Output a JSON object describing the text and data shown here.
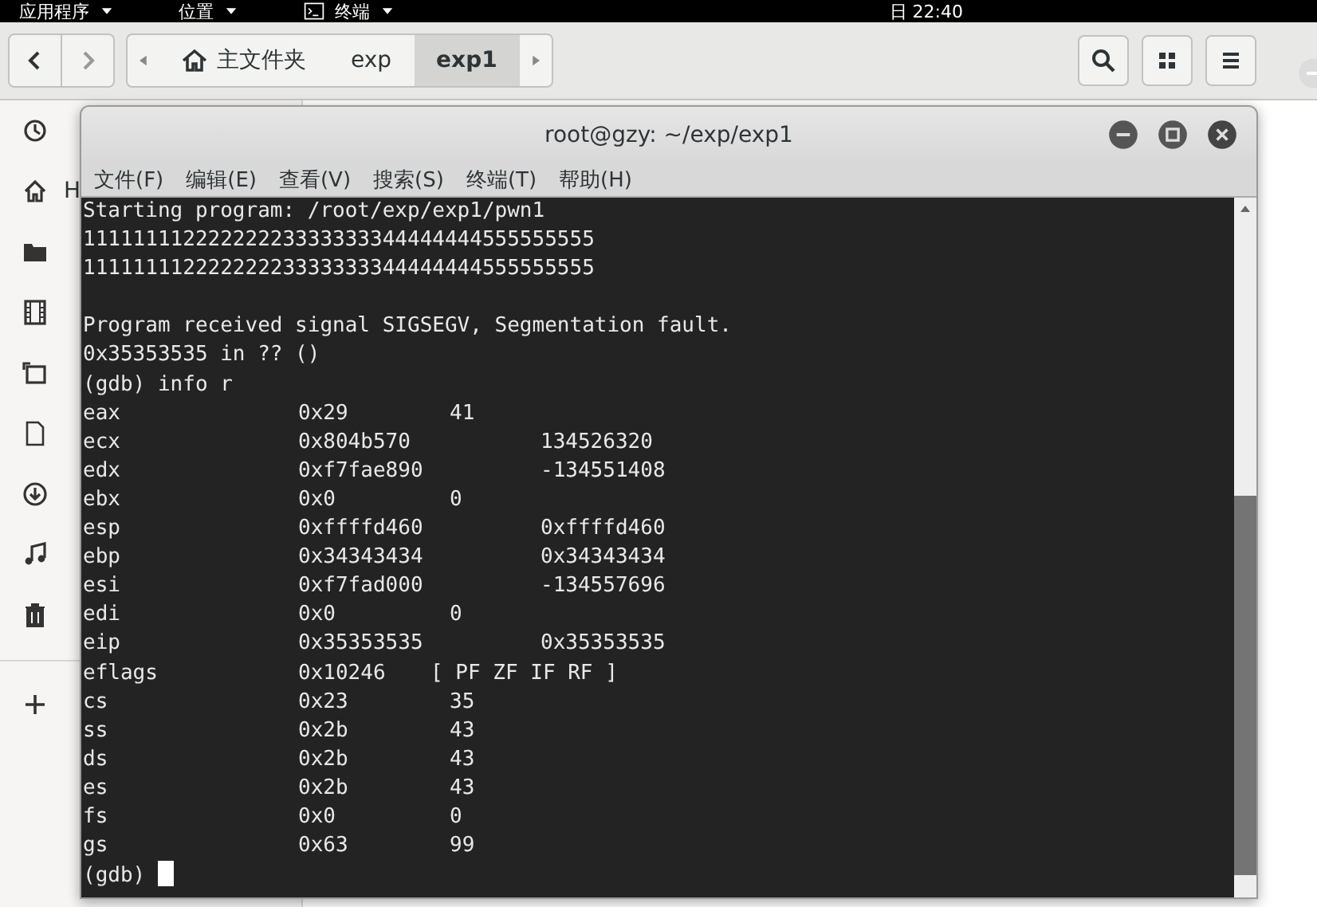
{
  "top_bar": {
    "menus": [
      {
        "label": "应用程序"
      },
      {
        "label": "位置"
      },
      {
        "label": "终端"
      }
    ],
    "clock": "日 22:40"
  },
  "file_manager": {
    "path": [
      {
        "label": "主文件夹",
        "kind": "home",
        "selected": false
      },
      {
        "label": "exp",
        "kind": "folder",
        "selected": false
      },
      {
        "label": "exp1",
        "kind": "folder",
        "selected": true
      }
    ],
    "sidebar": {
      "items": [
        {
          "kind": "icon"
        },
        {
          "kind": "labeled",
          "label": "H"
        },
        {
          "kind": "icon"
        },
        {
          "kind": "icon"
        },
        {
          "kind": "icon"
        },
        {
          "kind": "icon"
        },
        {
          "kind": "icon"
        },
        {
          "kind": "icon"
        },
        {
          "kind": "icon"
        },
        {
          "kind": "icon"
        }
      ]
    }
  },
  "terminal": {
    "title": "root@gzy: ~/exp/exp1",
    "menu": [
      "文件(F)",
      "编辑(E)",
      "查看(V)",
      "搜索(S)",
      "终端(T)",
      "帮助(H)"
    ],
    "lines": [
      {
        "kind": "text",
        "text": "Starting program: /root/exp/exp1/pwn1"
      },
      {
        "kind": "text",
        "text": "11111111222222223333333344444444555555555"
      },
      {
        "kind": "text",
        "text": "11111111222222223333333344444444555555555"
      },
      {
        "kind": "blank"
      },
      {
        "kind": "text",
        "text": "Program received signal SIGSEGV, Segmentation fault."
      },
      {
        "kind": "text",
        "text": "0x35353535 in ?? ()"
      },
      {
        "kind": "text",
        "text": "(gdb) info r"
      },
      {
        "kind": "register",
        "name": "eax",
        "hex": "0x29",
        "value": "41"
      },
      {
        "kind": "register",
        "name": "ecx",
        "hex": "0x804b570",
        "value": "134526320"
      },
      {
        "kind": "register",
        "name": "edx",
        "hex": "0xf7fae890",
        "value": "-134551408"
      },
      {
        "kind": "register",
        "name": "ebx",
        "hex": "0x0",
        "value": "0"
      },
      {
        "kind": "register",
        "name": "esp",
        "hex": "0xffffd460",
        "value": "0xffffd460"
      },
      {
        "kind": "register",
        "name": "ebp",
        "hex": "0x34343434",
        "value": "0x34343434"
      },
      {
        "kind": "register",
        "name": "esi",
        "hex": "0xf7fad000",
        "value": "-134557696"
      },
      {
        "kind": "register",
        "name": "edi",
        "hex": "0x0",
        "value": "0"
      },
      {
        "kind": "register",
        "name": "eip",
        "hex": "0x35353535",
        "value": "0x35353535"
      },
      {
        "kind": "register",
        "name": "eflags",
        "hex": "0x10246",
        "value": "[ PF ZF IF RF ]"
      },
      {
        "kind": "register",
        "name": "cs",
        "hex": "0x23",
        "value": "35"
      },
      {
        "kind": "register",
        "name": "ss",
        "hex": "0x2b",
        "value": "43"
      },
      {
        "kind": "register",
        "name": "ds",
        "hex": "0x2b",
        "value": "43"
      },
      {
        "kind": "register",
        "name": "es",
        "hex": "0x2b",
        "value": "43"
      },
      {
        "kind": "register",
        "name": "fs",
        "hex": "0x0",
        "value": "0"
      },
      {
        "kind": "register",
        "name": "gs",
        "hex": "0x63",
        "value": "99"
      },
      {
        "kind": "prompt",
        "text": "(gdb)"
      }
    ]
  }
}
